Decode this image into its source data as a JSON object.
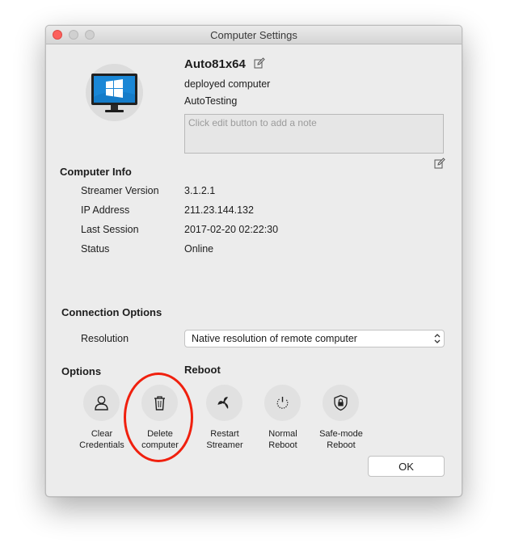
{
  "window": {
    "title": "Computer Settings"
  },
  "computer": {
    "name": "Auto81x64",
    "description": "deployed computer",
    "group": "AutoTesting",
    "note_placeholder": "Click edit button to add a note",
    "note_value": ""
  },
  "computer_info": {
    "heading": "Computer Info",
    "rows": [
      {
        "label": "Streamer Version",
        "value": "3.1.2.1"
      },
      {
        "label": "IP Address",
        "value": "211.23.144.132"
      },
      {
        "label": "Last Session",
        "value": "2017-02-20 02:22:30"
      },
      {
        "label": "Status",
        "value": "Online"
      }
    ]
  },
  "connection_options": {
    "heading": "Connection Options",
    "resolution_label": "Resolution",
    "resolution_selected": "Native resolution of remote computer"
  },
  "options": {
    "heading": "Options",
    "items": [
      {
        "line1": "Clear",
        "line2": "Credentials",
        "icon": "user-icon"
      },
      {
        "line1": "Delete",
        "line2": "computer",
        "icon": "trash-icon"
      }
    ]
  },
  "reboot": {
    "heading": "Reboot",
    "items": [
      {
        "line1": "Restart",
        "line2": "Streamer",
        "icon": "streamer-fan-icon"
      },
      {
        "line1": "Normal",
        "line2": "Reboot",
        "icon": "power-icon"
      },
      {
        "line1": "Safe-mode",
        "line2": "Reboot",
        "icon": "shield-lock-icon"
      }
    ]
  },
  "ok_label": "OK",
  "colors": {
    "monitor_blue": "#1a87d6",
    "highlight_red": "#f0200e",
    "close_red": "#fc605c"
  }
}
